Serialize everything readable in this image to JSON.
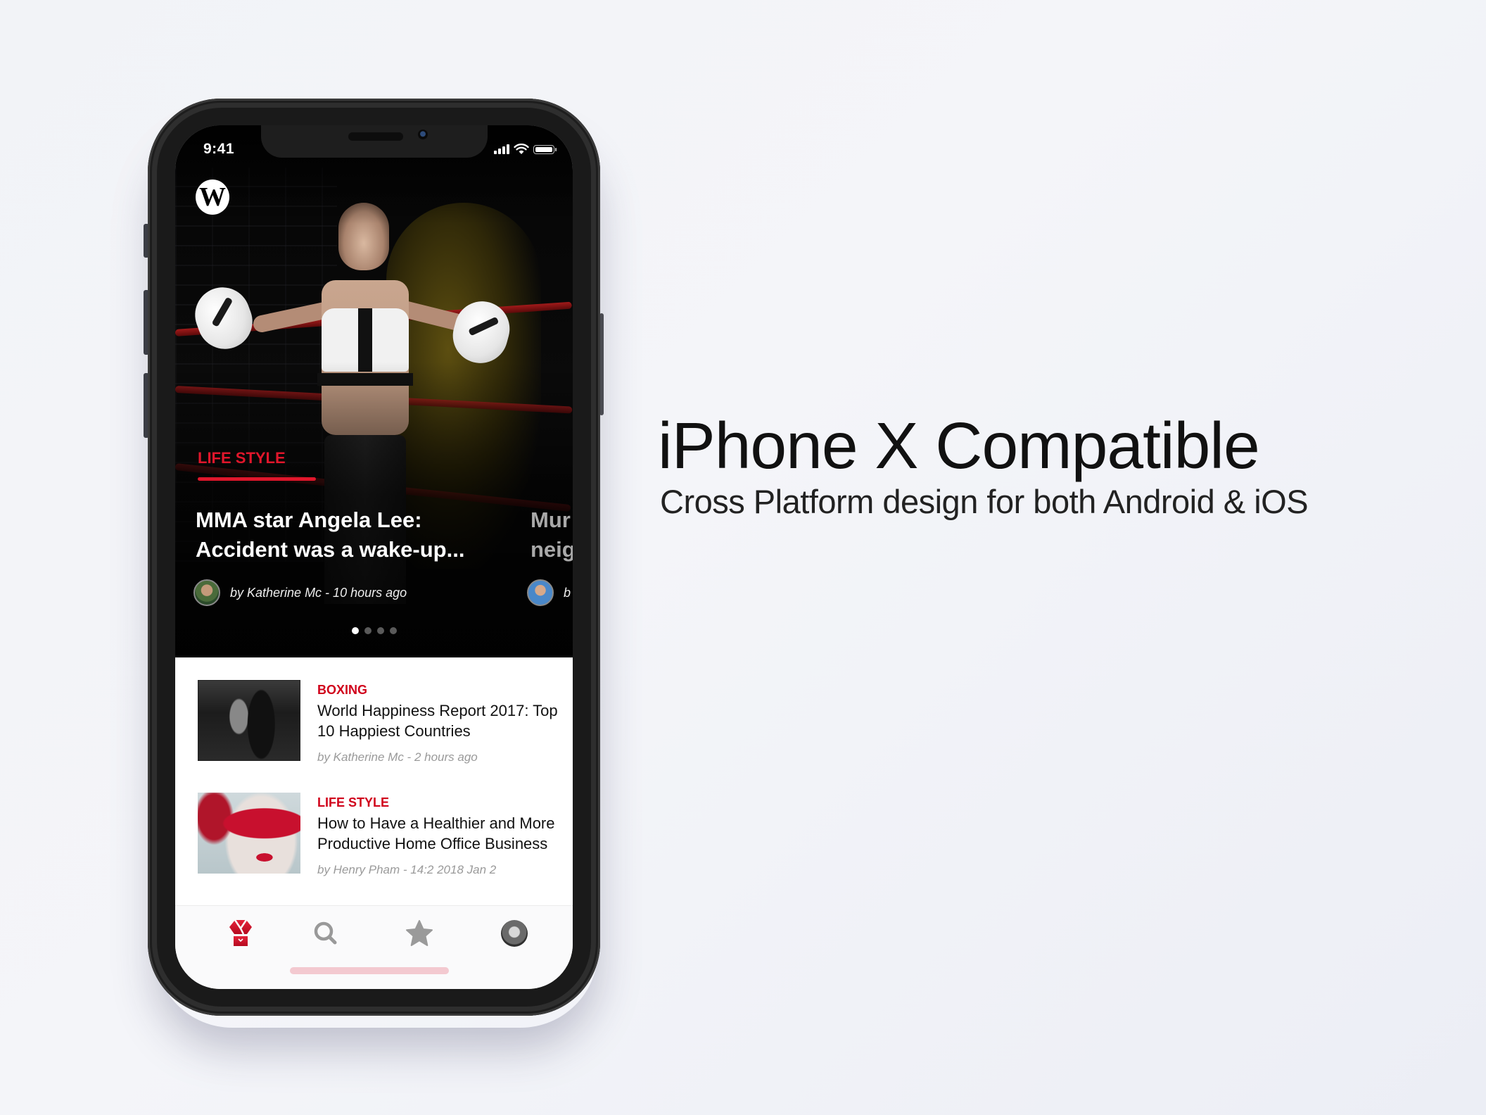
{
  "promo": {
    "headline": "iPhone X Compatible",
    "subheadline": "Cross Platform design for both Android & iOS"
  },
  "status_bar": {
    "time": "9:41",
    "icons": [
      "signal-icon",
      "wifi-icon",
      "battery-icon"
    ]
  },
  "app": {
    "logo_icon": "wordpress-logo-icon",
    "logo_glyph": "W",
    "accent_color": "#e0162b",
    "hero": {
      "active_slide": 1,
      "slide_count": 4,
      "slides": [
        {
          "category": "LIFE STYLE",
          "title": "MMA star Angela Lee: Accident was a wake-up...",
          "meta": "by  Katherine Mc  - 10 hours ago"
        },
        {
          "title_partial": "Mur\nneig",
          "meta_partial": "b"
        }
      ]
    },
    "articles": [
      {
        "category": "BOXING",
        "title": "World Happiness Report 2017: Top 10 Happiest Countries",
        "meta": "by  Katherine Mc  - 2 hours ago",
        "thumbnail": "boxing-gym-photo"
      },
      {
        "category": "LIFE STYLE",
        "title": "How to Have a Healthier and More Productive Home Office Business",
        "meta": "by  Henry Pham   - 14:2 2018 Jan 2",
        "thumbnail": "masquerade-mask-photo"
      }
    ],
    "tab_bar": [
      {
        "name": "home",
        "icon": "kimono-icon",
        "active": true
      },
      {
        "name": "search",
        "icon": "search-icon",
        "active": false
      },
      {
        "name": "favorites",
        "icon": "star-icon",
        "active": false
      },
      {
        "name": "profile",
        "icon": "profile-avatar",
        "active": false
      }
    ]
  }
}
